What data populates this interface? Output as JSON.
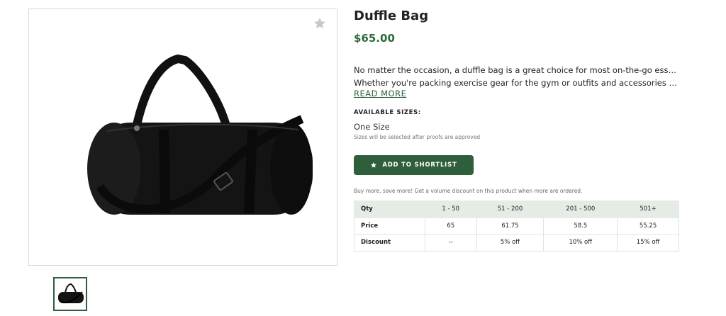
{
  "product": {
    "title": "Duffle Bag",
    "price": "$65.00",
    "description_line1": "No matter the occasion, a duffle bag is a great choice for most on-the-go essentials.",
    "description_line2": "Whether you're packing exercise gear for the gym or outfits and accessories for an...",
    "read_more": "READ MORE",
    "sizes_heading": "AVAILABLE SIZES:",
    "size_value": "One Size",
    "size_note": "Sizes will be selected after proofs are approved",
    "shortlist_label": "ADD TO SHORTLIST",
    "volume_note": "Buy more, save more! Get a volume discount on this product when more are ordered."
  },
  "pricing_table": {
    "header": [
      "Qty",
      "1 - 50",
      "51 - 200",
      "201 - 500",
      "501+"
    ],
    "price_row": [
      "Price",
      "65",
      "61.75",
      "58.5",
      "55.25"
    ],
    "discount_row": [
      "Discount",
      "--",
      "5% off",
      "10% off",
      "15% off"
    ]
  },
  "icons": {
    "favorite": "star-icon",
    "shortlist": "star-icon",
    "product_image": "duffle-bag-image"
  },
  "colors": {
    "brand_green": "#2e5e3a",
    "price_green": "#2e6b3a",
    "table_header_bg": "#e5ece6"
  }
}
